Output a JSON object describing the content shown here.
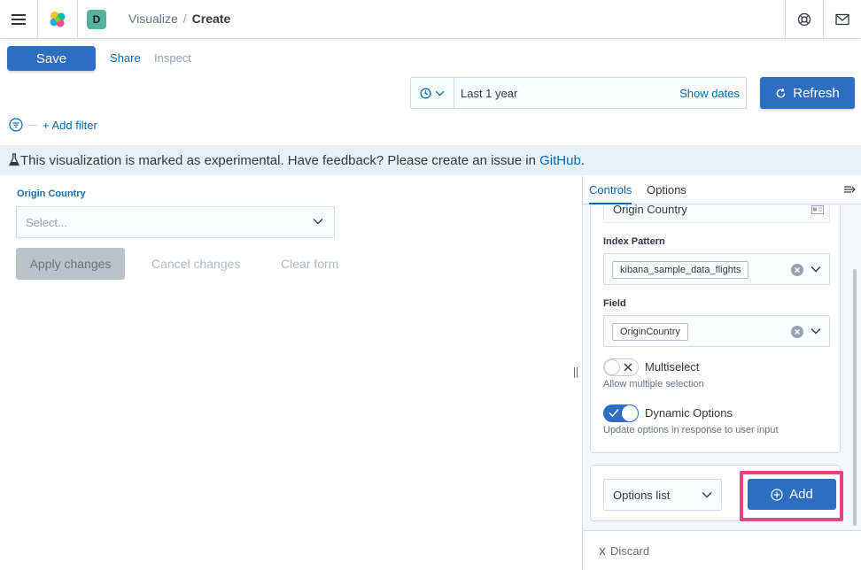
{
  "header": {
    "space_initial": "D",
    "breadcrumbs": [
      "Visualize",
      "Create"
    ],
    "breadcrumb_separator": "/"
  },
  "nav": {
    "save_label": "Save",
    "share_label": "Share",
    "inspect_label": "Inspect"
  },
  "query_bar": {
    "date_range": "Last 1 year",
    "show_dates_label": "Show dates",
    "refresh_label": "Refresh",
    "add_filter_label": "+ Add filter"
  },
  "banner": {
    "text": "This visualization is marked as experimental. Have feedback? Please create an issue in ",
    "link_text": "GitHub",
    "suffix": "."
  },
  "preview": {
    "control_label": "Origin Country",
    "select_placeholder": "Select...",
    "apply_label": "Apply changes",
    "cancel_label": "Cancel changes",
    "clear_label": "Clear form"
  },
  "sidebar": {
    "tabs": [
      {
        "label": "Controls",
        "active": true
      },
      {
        "label": "Options",
        "active": false
      }
    ],
    "control": {
      "title_value": "Origin Country",
      "index_pattern_label": "Index Pattern",
      "index_pattern_value": "kibana_sample_data_flights",
      "field_label": "Field",
      "field_value": "OriginCountry",
      "multiselect_label": "Multiselect",
      "multiselect_help": "Allow multiple selection",
      "multiselect_on": false,
      "dynamic_label": "Dynamic Options",
      "dynamic_help": "Update options in response to user input",
      "dynamic_on": true
    },
    "add_control": {
      "type_value": "Options list",
      "add_label": "Add"
    },
    "discard_label": "Discard"
  },
  "colors": {
    "primary": "#2c6ec1",
    "link": "#006bb8",
    "banner_bg": "#e6f1fa",
    "highlight": "#e5487f"
  }
}
